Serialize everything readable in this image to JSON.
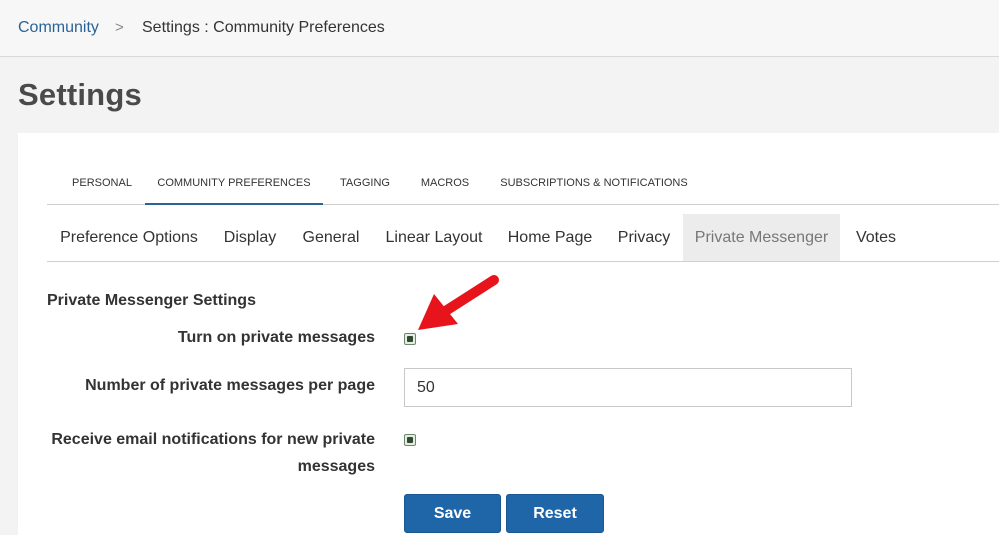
{
  "breadcrumb": {
    "link": "Community",
    "separator": ">",
    "current": "Settings : Community Preferences"
  },
  "page": {
    "title": "Settings"
  },
  "top_tabs": [
    {
      "label": "PERSONAL"
    },
    {
      "label": "COMMUNITY PREFERENCES",
      "active": true
    },
    {
      "label": "TAGGING"
    },
    {
      "label": "MACROS"
    },
    {
      "label": "SUBSCRIPTIONS & NOTIFICATIONS"
    }
  ],
  "sub_tabs": [
    {
      "label": "Preference Options"
    },
    {
      "label": "Display"
    },
    {
      "label": "General"
    },
    {
      "label": "Linear Layout"
    },
    {
      "label": "Home Page"
    },
    {
      "label": "Privacy"
    },
    {
      "label": "Private Messenger",
      "active": true
    },
    {
      "label": "Votes"
    }
  ],
  "form": {
    "section_title": "Private Messenger Settings",
    "turn_on_label": "Turn on private messages",
    "turn_on_checked": true,
    "per_page_label": "Number of private messages per page",
    "per_page_value": "50",
    "email_label_line1": "Receive email notifications for new private",
    "email_label_line2": "messages",
    "email_checked": true
  },
  "buttons": {
    "save": "Save",
    "reset": "Reset"
  },
  "annotation": {
    "arrow_icon": "red-arrow-icon",
    "color": "#e8141b"
  },
  "colors": {
    "accent": "#1f66a8",
    "link": "#2a6496"
  }
}
